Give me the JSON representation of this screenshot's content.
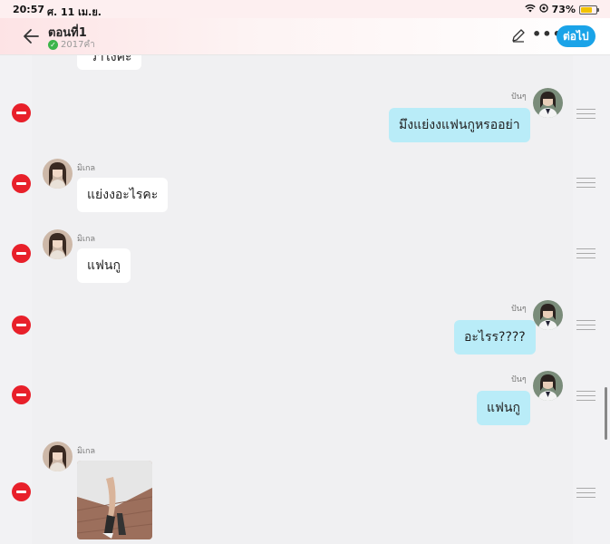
{
  "status_bar": {
    "time": "20:57",
    "date": "ศ. 11 เม.ย.",
    "battery": "73%",
    "battery_level": 0.73
  },
  "header": {
    "title": "ตอนที่1",
    "subtitle": "2017คำ",
    "next_label": "ต่อไป"
  },
  "chat": {
    "partial_message": "ว่าไงคะ",
    "messages": [
      {
        "sender": "ปันๆ",
        "side": "right",
        "text": "มึงแย่งงแฟนกูหรออย่า"
      },
      {
        "sender": "มิเกล",
        "side": "left",
        "text": "แย่งงอะไรคะ"
      },
      {
        "sender": "มิเกล",
        "side": "left",
        "text": "แฟนกู"
      },
      {
        "sender": "ปันๆ",
        "side": "right",
        "text": "อะไรร????"
      },
      {
        "sender": "ปันๆ",
        "side": "right",
        "text": "แฟนกู"
      },
      {
        "sender": "มิเกล",
        "side": "left",
        "text": ""
      }
    ]
  },
  "colors": {
    "accent": "#1aa3e8",
    "delete": "#e8202a",
    "bubble_right": "#b9ecf8",
    "bubble_left": "#ffffff"
  }
}
